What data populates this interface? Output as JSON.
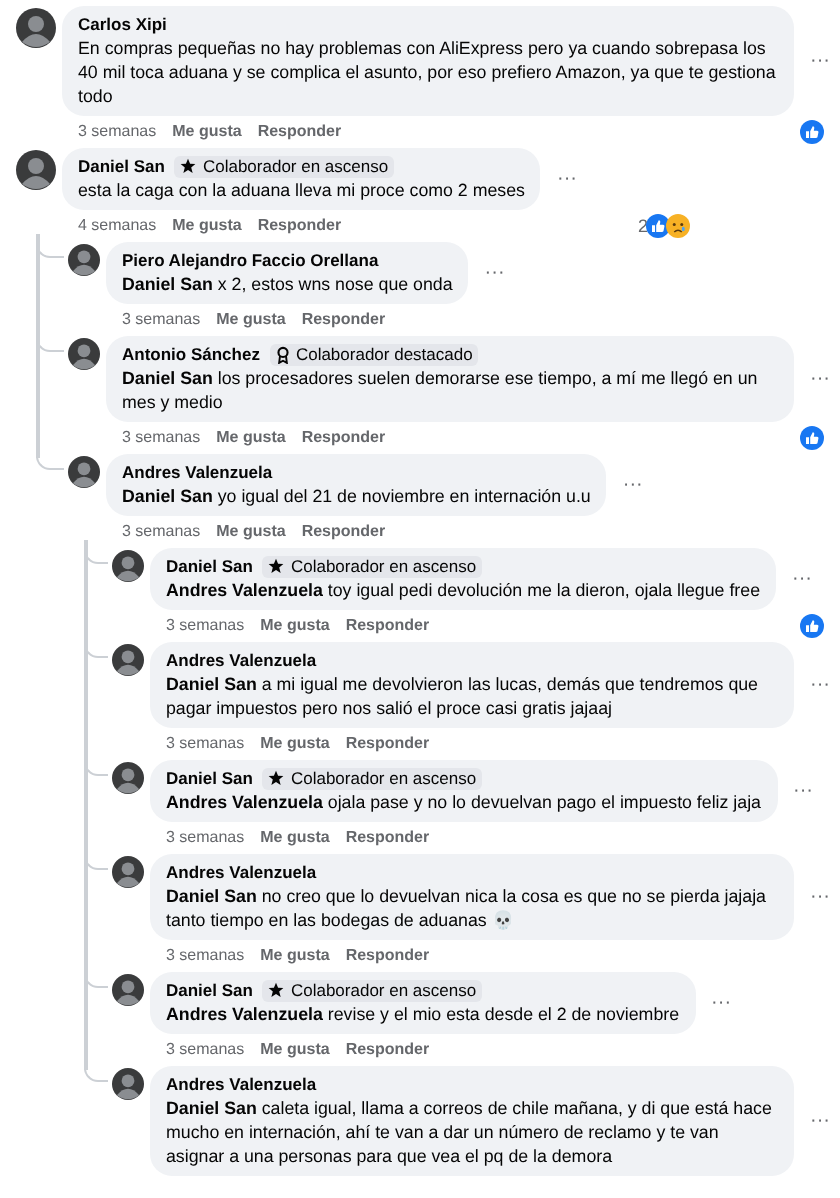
{
  "comments": [
    {
      "author": "Carlos Xipi",
      "text": "En compras pequeñas no hay problemas con AliExpress pero ya cuando sobrepasa los 40 mil toca aduana y se complica el asunto, por eso prefiero Amazon, ya que te gestiona todo",
      "menu": "···",
      "actions": {
        "time": "3 semanas",
        "like": "Me gusta",
        "reply": "Responder"
      },
      "reactions": [
        {
          "kind": "like"
        }
      ]
    },
    {
      "author": "Daniel San",
      "badge": {
        "kind": "star",
        "label": "Colaborador en ascenso"
      },
      "text": "esta la caga con la aduana lleva mi proce como 2 meses",
      "menu": "···",
      "actions": {
        "time": "4 semanas",
        "like": "Me gusta",
        "reply": "Responder"
      },
      "reaction_count": "2",
      "reactions": [
        {
          "kind": "like"
        },
        {
          "kind": "sad"
        }
      ],
      "children": [
        {
          "author": "Piero Alejandro Faccio Orellana",
          "text": "**Daniel San** x 2, estos wns nose que onda",
          "menu": "···",
          "actions": {
            "time": "3 semanas",
            "like": "Me gusta",
            "reply": "Responder"
          }
        },
        {
          "author": "Antonio Sánchez",
          "badge": {
            "kind": "award",
            "label": "Colaborador destacado"
          },
          "text": "**Daniel San** los procesadores suelen demorarse ese tiempo, a mí me llegó en un mes y medio",
          "menu": "···",
          "actions": {
            "time": "3 semanas",
            "like": "Me gusta",
            "reply": "Responder"
          },
          "reactions": [
            {
              "kind": "like"
            }
          ]
        },
        {
          "author": "Andres Valenzuela",
          "text": "**Daniel San** yo igual del 21 de noviembre en internación u.u",
          "menu": "···",
          "actions": {
            "time": "3 semanas",
            "like": "Me gusta",
            "reply": "Responder"
          },
          "children": [
            {
              "author": "Daniel San",
              "badge": {
                "kind": "star",
                "label": "Colaborador en ascenso"
              },
              "text": "**Andres Valenzuela** toy igual pedi devolución me la dieron, ojala llegue free",
              "menu": "···",
              "actions": {
                "time": "3 semanas",
                "like": "Me gusta",
                "reply": "Responder"
              },
              "reactions": [
                {
                  "kind": "like"
                }
              ]
            },
            {
              "author": "Andres Valenzuela",
              "text": "**Daniel San** a mi igual me devolvieron las lucas, demás que tendremos que pagar impuestos pero nos salió el proce casi gratis jajaaj",
              "menu": "···",
              "actions": {
                "time": "3 semanas",
                "like": "Me gusta",
                "reply": "Responder"
              }
            },
            {
              "author": "Daniel San",
              "badge": {
                "kind": "star",
                "label": "Colaborador en ascenso"
              },
              "text": "**Andres Valenzuela** ojala pase y no lo devuelvan pago el impuesto feliz jaja",
              "menu": "···",
              "actions": {
                "time": "3 semanas",
                "like": "Me gusta",
                "reply": "Responder"
              }
            },
            {
              "author": "Andres Valenzuela",
              "text": "**Daniel San** no creo que lo devuelvan nica la cosa es que no se pierda jajaja tanto tiempo en las bodegas de aduanas 💀",
              "menu": "···",
              "actions": {
                "time": "3 semanas",
                "like": "Me gusta",
                "reply": "Responder"
              }
            },
            {
              "author": "Daniel San",
              "badge": {
                "kind": "star",
                "label": "Colaborador en ascenso"
              },
              "text": "**Andres Valenzuela** revise y el mio esta desde el 2 de noviembre",
              "menu": "···",
              "actions": {
                "time": "3 semanas",
                "like": "Me gusta",
                "reply": "Responder"
              }
            },
            {
              "author": "Andres Valenzuela",
              "text": "**Daniel San** caleta igual, llama a correos de chile mañana, y di que está hace mucho en internación, ahí te van a dar un número de reclamo y te van asignar a una personas para que vea el pq de la demora",
              "menu": "···"
            }
          ]
        }
      ]
    }
  ]
}
